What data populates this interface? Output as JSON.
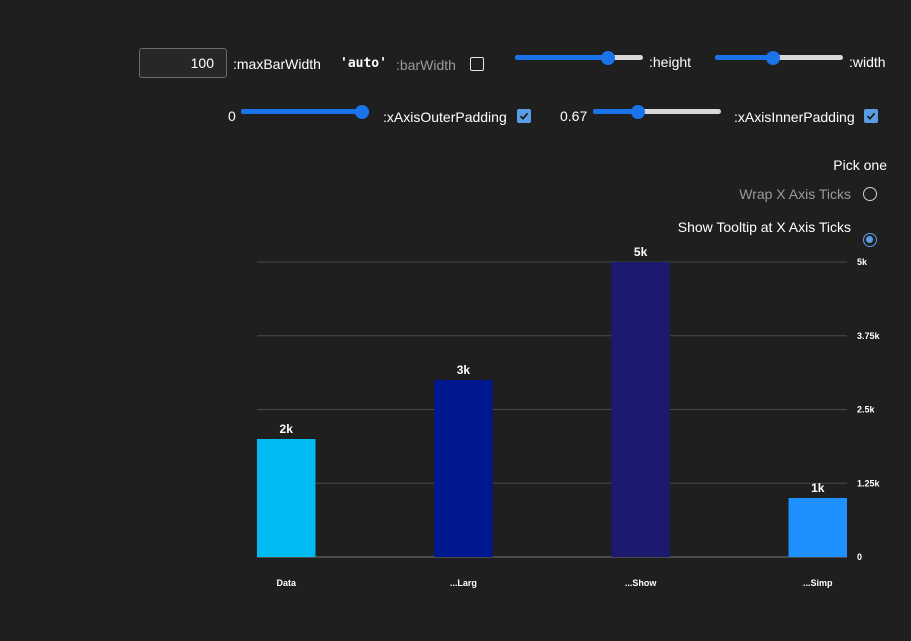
{
  "controls": {
    "max_bar_width_value": "100",
    "max_bar_width_label": ":maxBarWidth",
    "bar_width_value": "'auto'",
    "bar_width_label": ":barWidth",
    "bar_width_checked": false,
    "height_label": ":height",
    "height_level": 0.75,
    "width_label": ":width",
    "width_level": 0.45,
    "outer_padding_value": "0",
    "outer_padding_label": ":xAxisOuterPadding",
    "outer_padding_level": 1.0,
    "outer_padding_checked": true,
    "inner_padding_value": "0.67",
    "inner_padding_label": ":xAxisInnerPadding",
    "inner_padding_level": 0.33,
    "inner_padding_checked": true
  },
  "pick": {
    "title": "Pick one",
    "options": [
      {
        "label": "Wrap X Axis Ticks",
        "selected": false
      },
      {
        "label": "Show Tooltip at X Axis Ticks",
        "selected": true
      }
    ]
  },
  "chart_data": {
    "type": "bar",
    "categories": [
      "Data",
      "...Larg",
      "...Show",
      "...Simp"
    ],
    "values": [
      2000,
      3000,
      5000,
      1000
    ],
    "data_labels": [
      "2k",
      "3k",
      "5k",
      "1k"
    ],
    "colors": [
      "#00bcf2",
      "#00188f",
      "#1b1a6e",
      "#1e90ff"
    ],
    "ylim": [
      0,
      5000
    ],
    "yticks": [
      0,
      1250,
      2500,
      3750,
      5000
    ],
    "ytick_labels": [
      "0",
      "1.25k",
      "2.5k",
      "3.75k",
      "5k"
    ],
    "y_axis_side": "right",
    "grid": true
  }
}
